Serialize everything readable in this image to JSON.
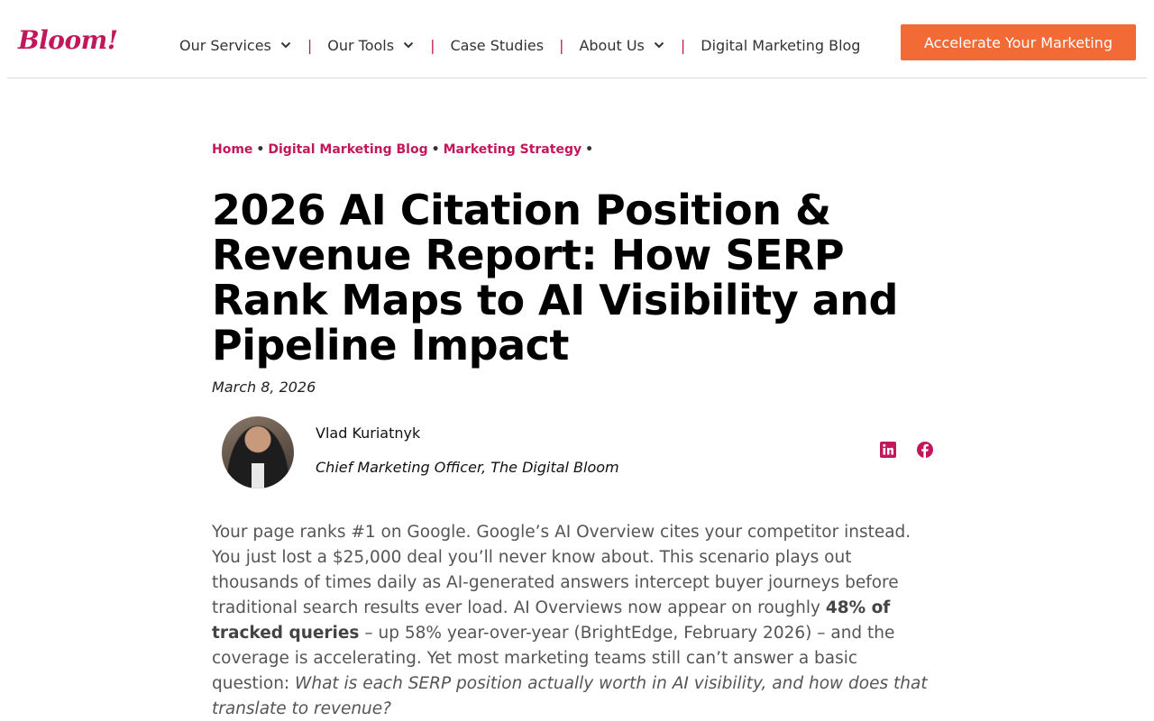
{
  "brand": {
    "logo_text": "Bloom!",
    "accent": "#c2185b",
    "cta_color": "#f26a35"
  },
  "nav": {
    "items": [
      {
        "label": "Our Services",
        "dropdown": true
      },
      {
        "label": "Our Tools",
        "dropdown": true
      },
      {
        "label": "Case Studies",
        "dropdown": false
      },
      {
        "label": "About Us",
        "dropdown": true
      },
      {
        "label": "Digital Marketing Blog",
        "dropdown": false
      }
    ],
    "separator": "|",
    "cta_label": "Accelerate Your Marketing"
  },
  "breadcrumb": {
    "items": [
      "Home",
      "Digital Marketing Blog",
      "Marketing Strategy"
    ],
    "separator": "•"
  },
  "article": {
    "title": "2026 AI Citation Position & Revenue Report: How SERP Rank Maps to AI Visibility and Pipeline Impact",
    "date": "March 8, 2026",
    "author": {
      "name": "Vlad Kuriatnyk",
      "role": "Chief Marketing Officer, The Digital Bloom",
      "avatar_icon": "author-photo"
    },
    "share": [
      {
        "network": "LinkedIn",
        "icon": "linkedin-icon"
      },
      {
        "network": "Facebook",
        "icon": "facebook-icon"
      }
    ],
    "intro": {
      "p1": "Your page ranks #1 on Google. Google’s AI Overview cites your competitor instead. You just lost a $25,000 deal you’ll never know about. This scenario plays out thousands of times daily as AI-generated answers intercept buyer journeys before traditional search results ever load. AI Overviews now appear on roughly ",
      "bold": "48% of tracked queries",
      "p2": " –  up 58% year-over-year (BrightEdge, February 2026) –  and the coverage is accelerating. Yet most marketing teams still can’t answer a basic question: ",
      "italic": "What is each SERP position actually worth in AI visibility, and how does that translate to revenue?"
    }
  }
}
